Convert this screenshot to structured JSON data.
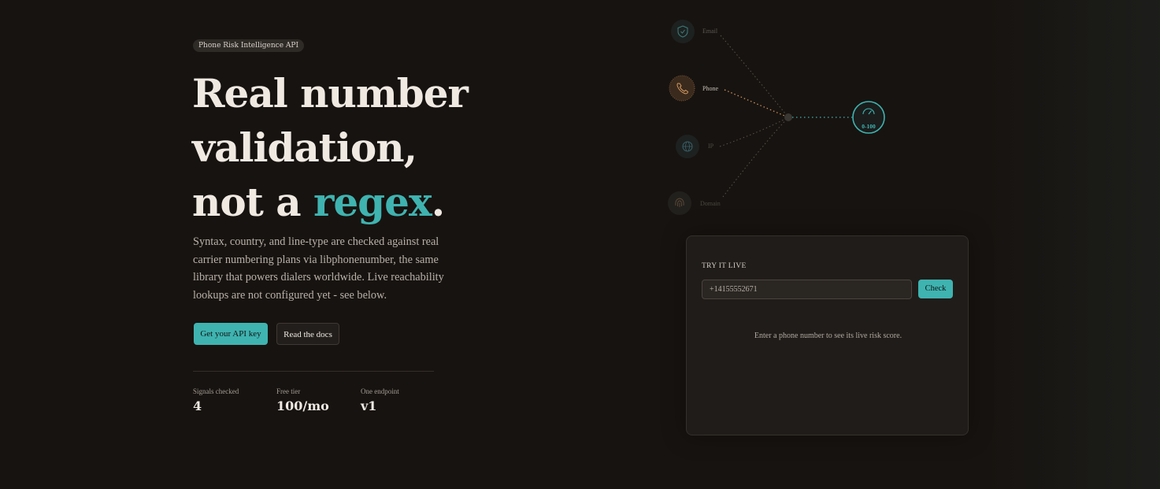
{
  "hero": {
    "badge": "Phone Risk Intelligence API",
    "headline_line1": "Real number",
    "headline_line2": "validation,",
    "headline_line3_prefix": "not a ",
    "headline_accent": "regex",
    "headline_suffix": ".",
    "description": "Syntax, country, and line-type are checked against real carrier numbering plans via libphonenumber, the same library that powers dialers worldwide. Live reachability lookups are not configured yet - see below.",
    "primary_cta": "Get your API key",
    "secondary_cta": "Read the docs"
  },
  "stats": [
    {
      "label": "Signals checked",
      "value": "4"
    },
    {
      "label": "Free tier",
      "value": "100/mo"
    },
    {
      "label": "One endpoint",
      "value": "v1"
    }
  ],
  "signals": {
    "inputs": [
      {
        "name": "Email",
        "icon": "shield-icon",
        "active": false
      },
      {
        "name": "Phone",
        "icon": "phone-icon",
        "active": true
      },
      {
        "name": "IP",
        "icon": "globe-icon",
        "active": false
      },
      {
        "name": "Domain",
        "icon": "fingerprint-icon",
        "active": false
      }
    ],
    "output_label": "0-100",
    "output_icon": "gauge-icon"
  },
  "try_panel": {
    "title": "TRY IT LIVE",
    "input_value": "+14155552671",
    "check_label": "Check",
    "hint": "Enter a phone number to see its live risk score."
  },
  "colors": {
    "background": "#171310",
    "accent": "#3fb3b0",
    "phone_accent": "#c9905a",
    "text": "#efe9e2"
  }
}
